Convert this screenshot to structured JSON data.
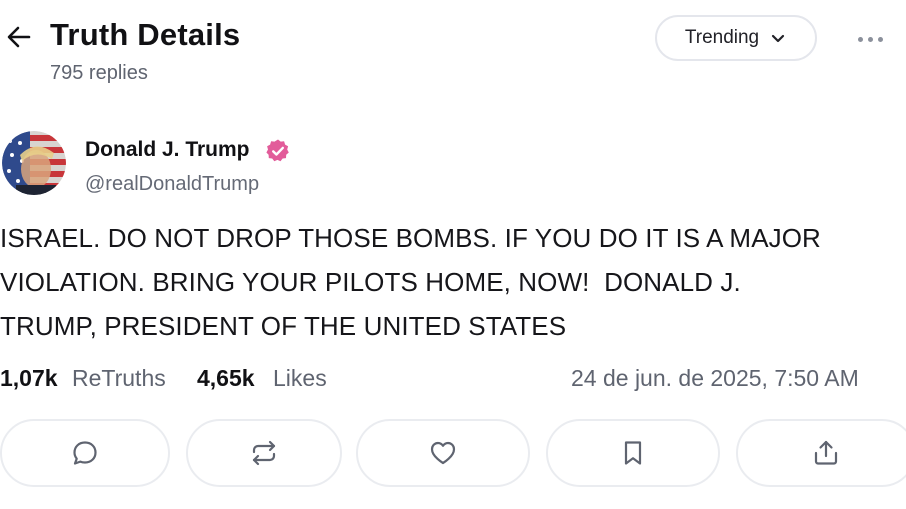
{
  "header": {
    "title": "Truth Details",
    "replies": "795 replies",
    "sort_label": "Trending",
    "back_icon": "arrow-left-icon",
    "more_icon": "ellipsis-icon"
  },
  "author": {
    "name": "Donald J. Trump",
    "handle": "@realDonaldTrump",
    "verified_color": "#e25c9a"
  },
  "post": {
    "text": "ISRAEL. DO NOT DROP THOSE BOMBS. IF YOU DO IT IS A MAJOR\nVIOLATION. BRING YOUR PILOTS HOME, NOW!  DONALD J.\nTRUMP, PRESIDENT OF THE UNITED STATES"
  },
  "stats": {
    "retruths_count": "1,07k",
    "retruths_label": "ReTruths",
    "likes_count": "4,65k",
    "likes_label": "Likes",
    "timestamp": "24 de jun. de 2025, 7:50 AM"
  },
  "actions": [
    {
      "icon": "reply-icon"
    },
    {
      "icon": "retruth-icon"
    },
    {
      "icon": "like-icon"
    },
    {
      "icon": "bookmark-icon"
    },
    {
      "icon": "share-icon"
    }
  ],
  "colors": {
    "text": "#111114",
    "muted": "#5f6470",
    "border": "#eaecf0",
    "verified": "#e25c9a"
  }
}
